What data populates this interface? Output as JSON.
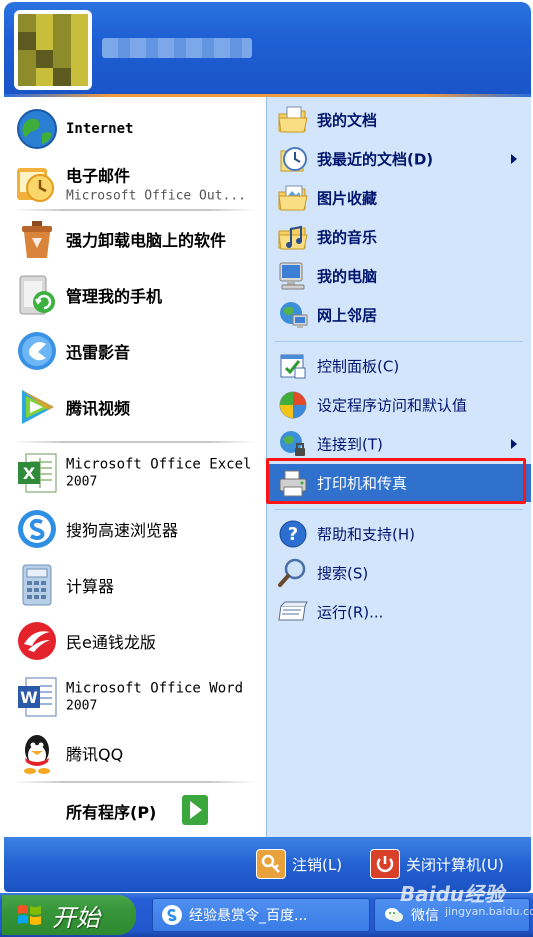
{
  "header": {
    "username": ""
  },
  "left_pane": {
    "items": [
      {
        "title": "Internet",
        "sub": "",
        "icon": "internet-explorer-icon"
      },
      {
        "title": "电子邮件",
        "sub": "Microsoft Office Out...",
        "icon": "outlook-icon"
      },
      {
        "title": "强力卸载电脑上的软件",
        "sub": "",
        "icon": "uninstall-icon"
      },
      {
        "title": "管理我的手机",
        "sub": "",
        "icon": "phone-manager-icon"
      },
      {
        "title": "迅雷影音",
        "sub": "",
        "icon": "xunlei-player-icon"
      },
      {
        "title": "腾讯视频",
        "sub": "",
        "icon": "tencent-video-icon"
      },
      {
        "title": "Microsoft Office Excel",
        "sub": "2007",
        "icon": "excel-icon"
      },
      {
        "title": "搜狗高速浏览器",
        "sub": "",
        "icon": "sogou-browser-icon"
      },
      {
        "title": "计算器",
        "sub": "",
        "icon": "calculator-icon"
      },
      {
        "title": "民e通钱龙版",
        "sub": "",
        "icon": "qianlong-icon"
      },
      {
        "title": "Microsoft Office Word",
        "sub": "2007",
        "icon": "word-icon"
      },
      {
        "title": "腾讯QQ",
        "sub": "",
        "icon": "qq-icon"
      }
    ],
    "all_programs": "所有程序(P)"
  },
  "right_pane": {
    "items": [
      {
        "label": "我的文档",
        "bold": true,
        "arrow": false,
        "icon": "my-documents-icon"
      },
      {
        "label": "我最近的文档(D)",
        "bold": true,
        "arrow": true,
        "icon": "recent-documents-icon"
      },
      {
        "label": "图片收藏",
        "bold": true,
        "arrow": false,
        "icon": "my-pictures-icon"
      },
      {
        "label": "我的音乐",
        "bold": true,
        "arrow": false,
        "icon": "my-music-icon"
      },
      {
        "label": "我的电脑",
        "bold": true,
        "arrow": false,
        "icon": "my-computer-icon"
      },
      {
        "label": "网上邻居",
        "bold": true,
        "arrow": false,
        "icon": "network-places-icon"
      },
      {
        "label": "控制面板(C)",
        "bold": false,
        "arrow": false,
        "icon": "control-panel-icon"
      },
      {
        "label": "设定程序访问和默认值",
        "bold": false,
        "arrow": false,
        "icon": "program-defaults-icon"
      },
      {
        "label": "连接到(T)",
        "bold": false,
        "arrow": true,
        "icon": "connect-to-icon"
      },
      {
        "label": "打印机和传真",
        "bold": false,
        "arrow": false,
        "icon": "printer-fax-icon",
        "selected": true
      },
      {
        "label": "帮助和支持(H)",
        "bold": false,
        "arrow": false,
        "icon": "help-icon"
      },
      {
        "label": "搜索(S)",
        "bold": false,
        "arrow": false,
        "icon": "search-icon"
      },
      {
        "label": "运行(R)...",
        "bold": false,
        "arrow": false,
        "icon": "run-icon"
      }
    ]
  },
  "footer": {
    "logoff": "注销(L)",
    "shutdown": "关闭计算机(U)"
  },
  "taskbar": {
    "start": "开始",
    "tasks": [
      {
        "label": "经验悬赏令_百度...",
        "icon": "sogou-icon"
      },
      {
        "label": "微信",
        "icon": "wechat-icon"
      }
    ]
  },
  "watermark": {
    "text": "Baidu经验",
    "sub": "jingyan.baidu.com"
  },
  "colors": {
    "header_blue": "#1f5fd5",
    "right_pane_bg": "#d3e5fa",
    "selected_bg": "#2f71cd",
    "highlight_red": "#ff1414",
    "start_green": "#37953a"
  }
}
